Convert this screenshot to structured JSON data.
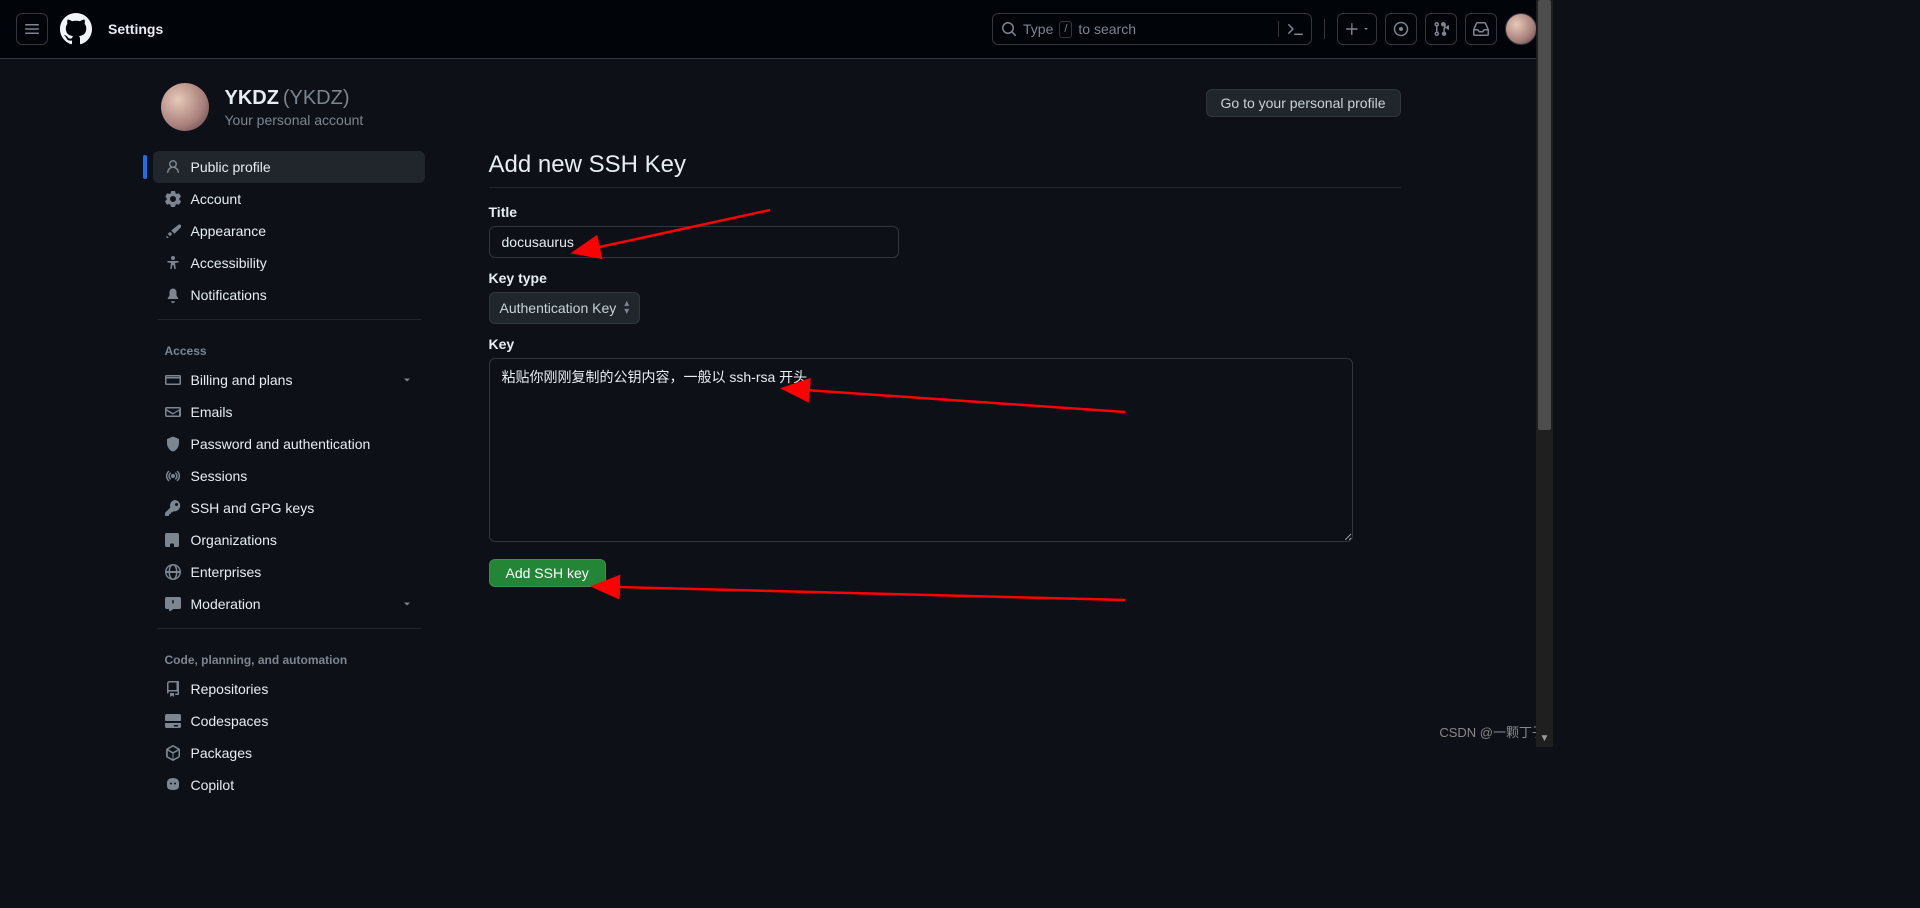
{
  "header": {
    "title": "Settings",
    "search_prefix": "Type ",
    "search_key": "/",
    "search_suffix": " to search"
  },
  "profile_banner": {
    "name": "YKDZ",
    "alias": "(YKDZ)",
    "subtitle": "Your personal account",
    "go_to_profile": "Go to your personal profile"
  },
  "sidebar": {
    "items_top": [
      {
        "label": "Public profile",
        "icon": "person"
      },
      {
        "label": "Account",
        "icon": "gear"
      },
      {
        "label": "Appearance",
        "icon": "paintbrush"
      },
      {
        "label": "Accessibility",
        "icon": "accessibility"
      },
      {
        "label": "Notifications",
        "icon": "bell"
      }
    ],
    "section_access_title": "Access",
    "items_access": [
      {
        "label": "Billing and plans",
        "icon": "credit-card",
        "chevron": true
      },
      {
        "label": "Emails",
        "icon": "mail"
      },
      {
        "label": "Password and authentication",
        "icon": "shield-lock"
      },
      {
        "label": "Sessions",
        "icon": "broadcast"
      },
      {
        "label": "SSH and GPG keys",
        "icon": "key"
      },
      {
        "label": "Organizations",
        "icon": "organization"
      },
      {
        "label": "Enterprises",
        "icon": "globe"
      },
      {
        "label": "Moderation",
        "icon": "report",
        "chevron": true
      }
    ],
    "section_code_title": "Code, planning, and automation",
    "items_code": [
      {
        "label": "Repositories",
        "icon": "repo"
      },
      {
        "label": "Codespaces",
        "icon": "codespaces"
      },
      {
        "label": "Packages",
        "icon": "package"
      },
      {
        "label": "Copilot",
        "icon": "copilot"
      }
    ]
  },
  "main": {
    "heading": "Add new SSH Key",
    "title_label": "Title",
    "title_value": "docusaurus",
    "keytype_label": "Key type",
    "keytype_value": "Authentication Key",
    "key_label": "Key",
    "key_value": "粘贴你刚刚复制的公钥内容，一般以 ssh-rsa 开头",
    "submit_label": "Add SSH key"
  },
  "watermark": "CSDN @一颗丁子"
}
